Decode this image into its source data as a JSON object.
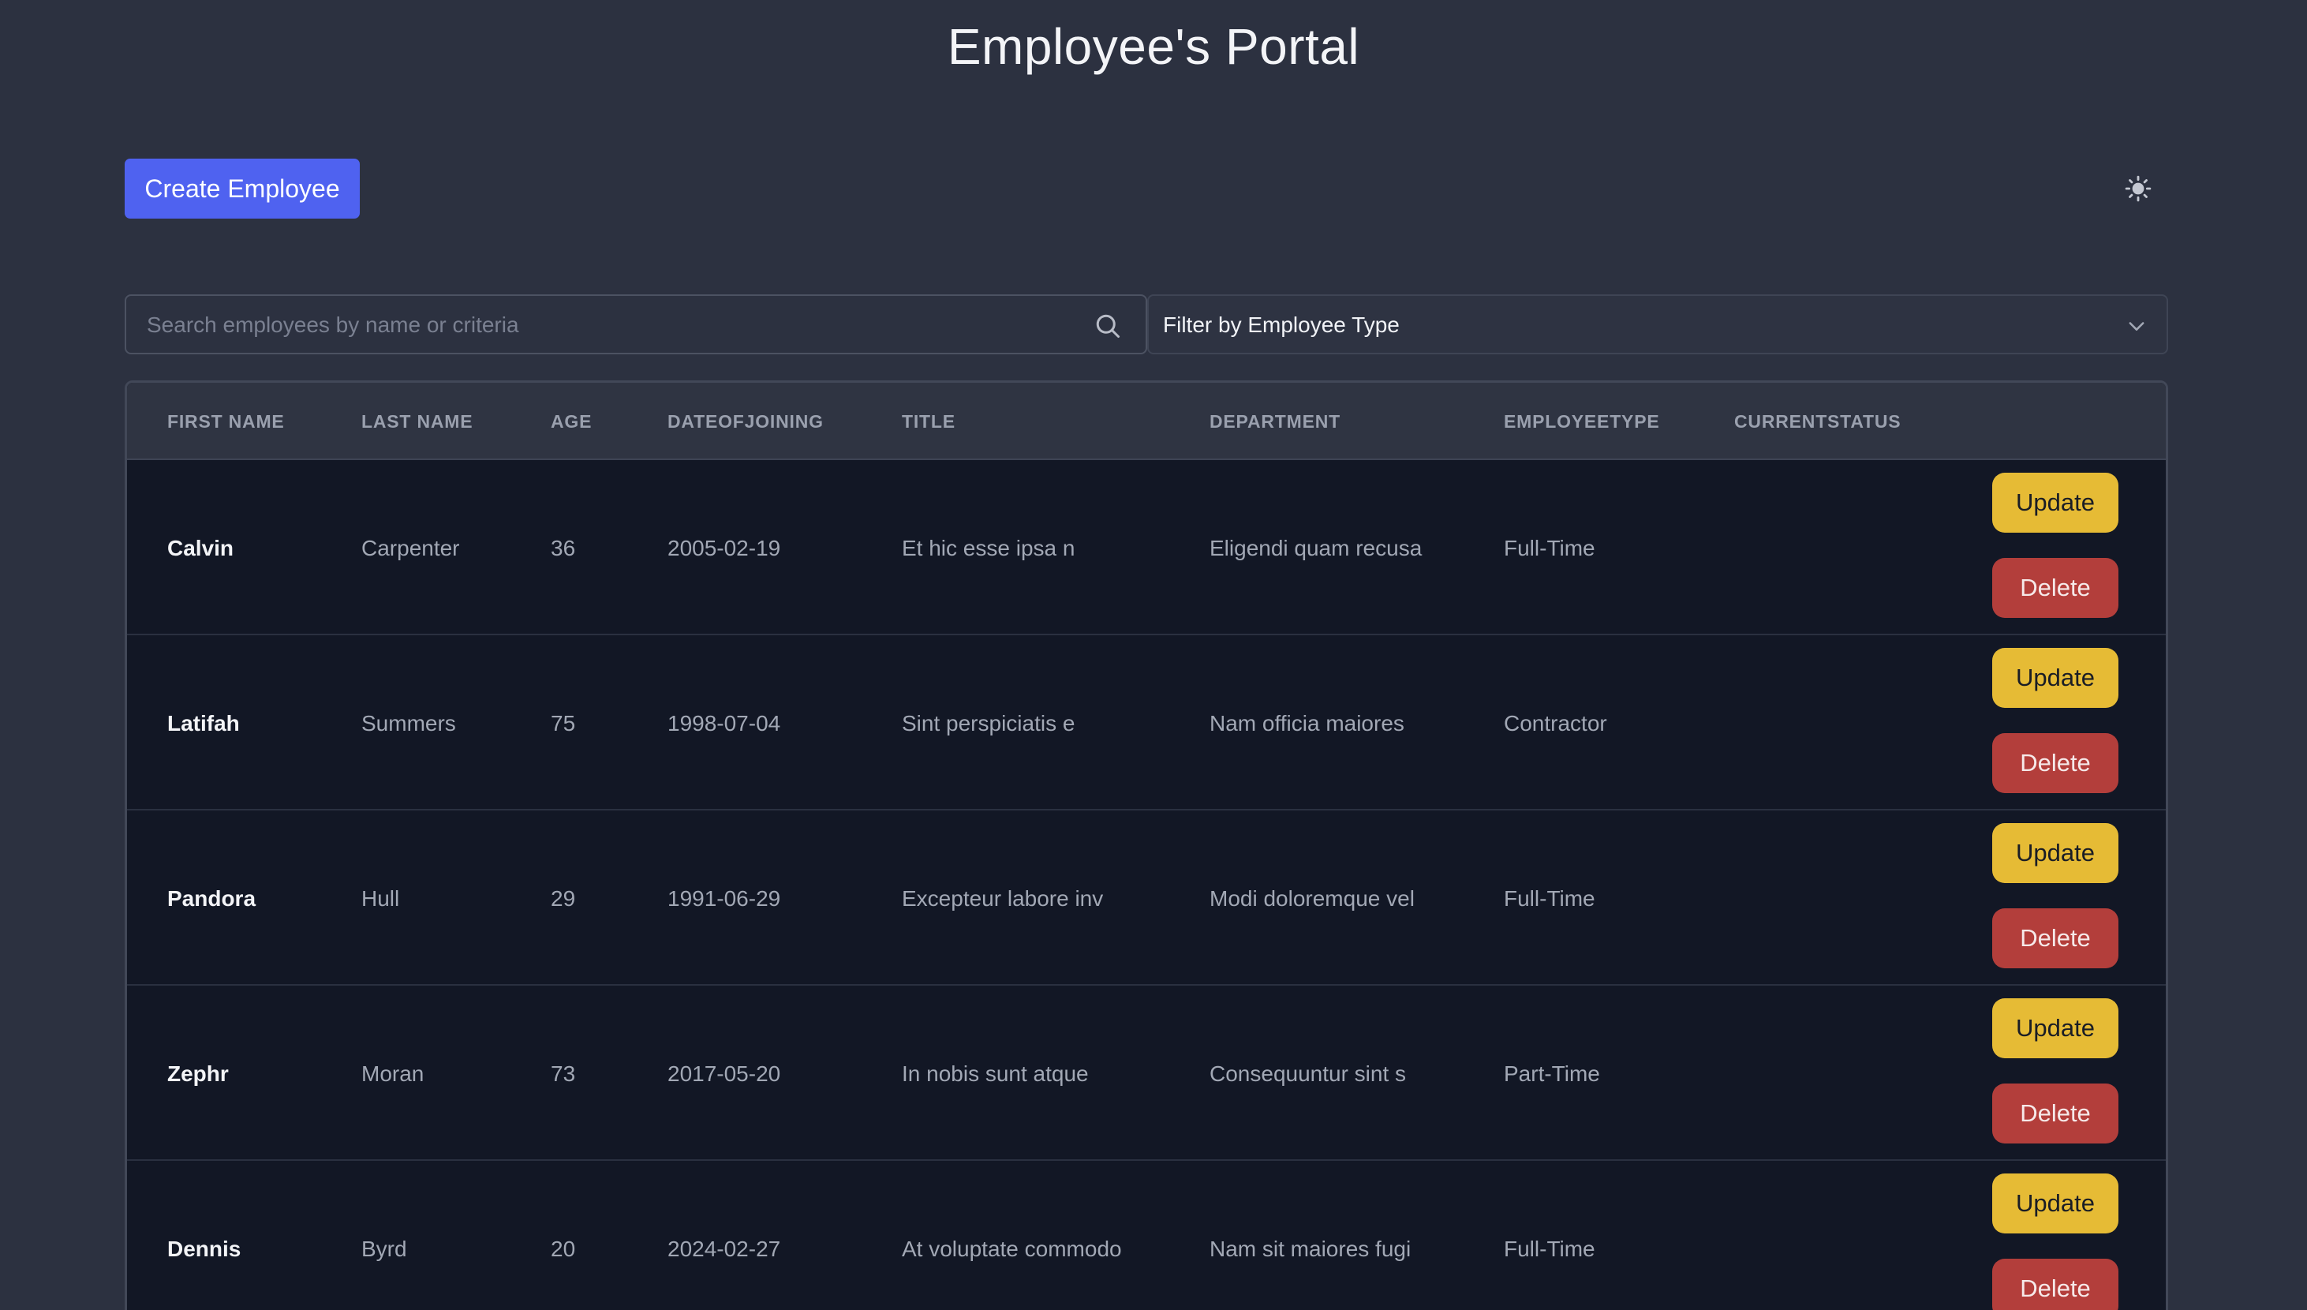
{
  "page": {
    "title": "Employee's Portal"
  },
  "toolbar": {
    "create_label": "Create Employee",
    "theme_icon": "sun-icon"
  },
  "search": {
    "placeholder": "Search employees by name or criteria",
    "value": "",
    "icon": "search-icon"
  },
  "filter": {
    "selected": "Filter by Employee Type",
    "icon": "chevron-down-icon"
  },
  "table": {
    "columns": [
      "FIRST NAME",
      "LAST NAME",
      "AGE",
      "DATEOFJOINING",
      "TITLE",
      "DEPARTMENT",
      "EMPLOYEETYPE",
      "CURRENTSTATUS"
    ],
    "update_label": "Update",
    "delete_label": "Delete",
    "rows": [
      {
        "first": "Calvin",
        "last": "Carpenter",
        "age": "36",
        "doj": "2005-02-19",
        "title": "Et hic esse ipsa n",
        "department": "Eligendi quam recusa",
        "type": "Full-Time",
        "status": ""
      },
      {
        "first": "Latifah",
        "last": "Summers",
        "age": "75",
        "doj": "1998-07-04",
        "title": "Sint perspiciatis e",
        "department": "Nam officia maiores",
        "type": "Contractor",
        "status": ""
      },
      {
        "first": "Pandora",
        "last": "Hull",
        "age": "29",
        "doj": "1991-06-29",
        "title": "Excepteur labore inv",
        "department": "Modi doloremque vel",
        "type": "Full-Time",
        "status": ""
      },
      {
        "first": "Zephr",
        "last": "Moran",
        "age": "73",
        "doj": "2017-05-20",
        "title": "In nobis sunt atque",
        "department": "Consequuntur sint s",
        "type": "Part-Time",
        "status": ""
      },
      {
        "first": "Dennis",
        "last": "Byrd",
        "age": "20",
        "doj": "2024-02-27",
        "title": "At voluptate commodo",
        "department": "Nam sit maiores fugi",
        "type": "Full-Time",
        "status": ""
      }
    ]
  },
  "colors": {
    "background": "#2c3140",
    "primary": "#4f62f0",
    "update": "#e6bb35",
    "delete": "#b33e3b",
    "table_body": "#121725"
  }
}
